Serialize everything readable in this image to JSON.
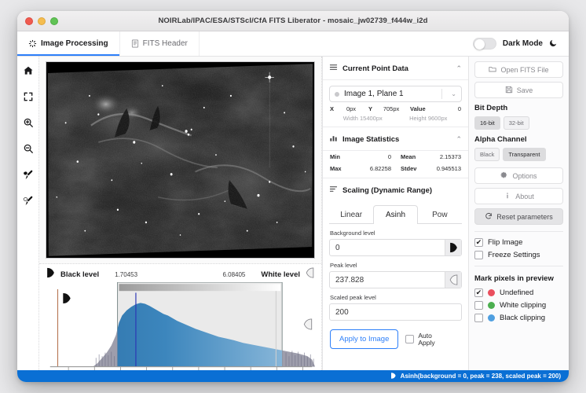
{
  "window": {
    "title": "NOIRLab/IPAC/ESA/STScI/CfA FITS Liberator - mosaic_jw02739_f444w_i2d"
  },
  "tabs": [
    {
      "label": "Image Processing",
      "icon": "loading-spinner-icon",
      "active": true
    },
    {
      "label": "FITS Header",
      "icon": "document-icon",
      "active": false
    }
  ],
  "dark_mode": {
    "label": "Dark Mode",
    "icon": "moon-icon",
    "enabled": false
  },
  "rail": [
    {
      "name": "home-icon"
    },
    {
      "name": "fit-to-screen-icon"
    },
    {
      "name": "zoom-in-icon"
    },
    {
      "name": "zoom-out-icon"
    },
    {
      "name": "black-level-picker-icon"
    },
    {
      "name": "white-level-picker-icon"
    }
  ],
  "histogram": {
    "black_level_label": "Black level",
    "black_level_value": "1.70453",
    "white_level_label": "White level",
    "white_level_value": "6.08405"
  },
  "current_point_data": {
    "title": "Current Point Data",
    "icon": "list-icon",
    "collapse_icon": "chevron-up-icon",
    "plane_select": "Image 1, Plane 1",
    "x_label": "X",
    "x_value": "0px",
    "y_label": "Y",
    "y_value": "705px",
    "value_label": "Value",
    "value_value": "0",
    "width_label": "Width 15400px",
    "height_label": "Height 9600px"
  },
  "image_statistics": {
    "title": "Image Statistics",
    "icon": "bar-chart-icon",
    "collapse_icon": "chevron-up-icon",
    "min_label": "Min",
    "min_value": "0",
    "mean_label": "Mean",
    "mean_value": "2.15373",
    "max_label": "Max",
    "max_value": "6.82258",
    "stdev_label": "Stdev",
    "stdev_value": "0.945513"
  },
  "scaling": {
    "title": "Scaling (Dynamic Range)",
    "icon": "sliders-icon",
    "tabs": [
      {
        "label": "Linear",
        "active": false
      },
      {
        "label": "Asinh",
        "active": true
      },
      {
        "label": "Pow",
        "active": false
      }
    ],
    "background_level_label": "Background level",
    "background_level_value": "0",
    "peak_level_label": "Peak level",
    "peak_level_value": "237.828",
    "scaled_peak_level_label": "Scaled peak level",
    "scaled_peak_level_value": "200",
    "apply_label": "Apply to Image",
    "auto_apply_label": "Auto\nApply",
    "auto_apply_checked": false
  },
  "right_panel": {
    "open_file": {
      "label": "Open FITS File",
      "icon": "folder-open-icon"
    },
    "save": {
      "label": "Save",
      "icon": "save-icon"
    },
    "bit_depth_label": "Bit Depth",
    "bit_depth_options": [
      {
        "label": "16-bit",
        "selected": true
      },
      {
        "label": "32-bit",
        "selected": false
      }
    ],
    "alpha_channel_label": "Alpha Channel",
    "alpha_channel_options": [
      {
        "label": "Black",
        "selected": false
      },
      {
        "label": "Transparent",
        "selected": true
      }
    ],
    "options": {
      "label": "Options",
      "icon": "gear-icon"
    },
    "about": {
      "label": "About",
      "icon": "info-icon"
    },
    "reset": {
      "label": "Reset parameters",
      "icon": "refresh-icon"
    },
    "flip_image": {
      "label": "Flip Image",
      "checked": true
    },
    "freeze_settings": {
      "label": "Freeze Settings",
      "checked": false
    },
    "mark_pixels_label": "Mark pixels in preview",
    "mark_pixels": [
      {
        "label": "Undefined",
        "color": "#ea4f5e",
        "checked": true
      },
      {
        "label": "White clipping",
        "color": "#4caf50",
        "checked": false
      },
      {
        "label": "Black clipping",
        "color": "#4f9fe0",
        "checked": false
      }
    ]
  },
  "status_bar": {
    "icon": "droplet-icon",
    "text": "Asinh(background = 0, peak = 238, scaled peak = 200)"
  }
}
